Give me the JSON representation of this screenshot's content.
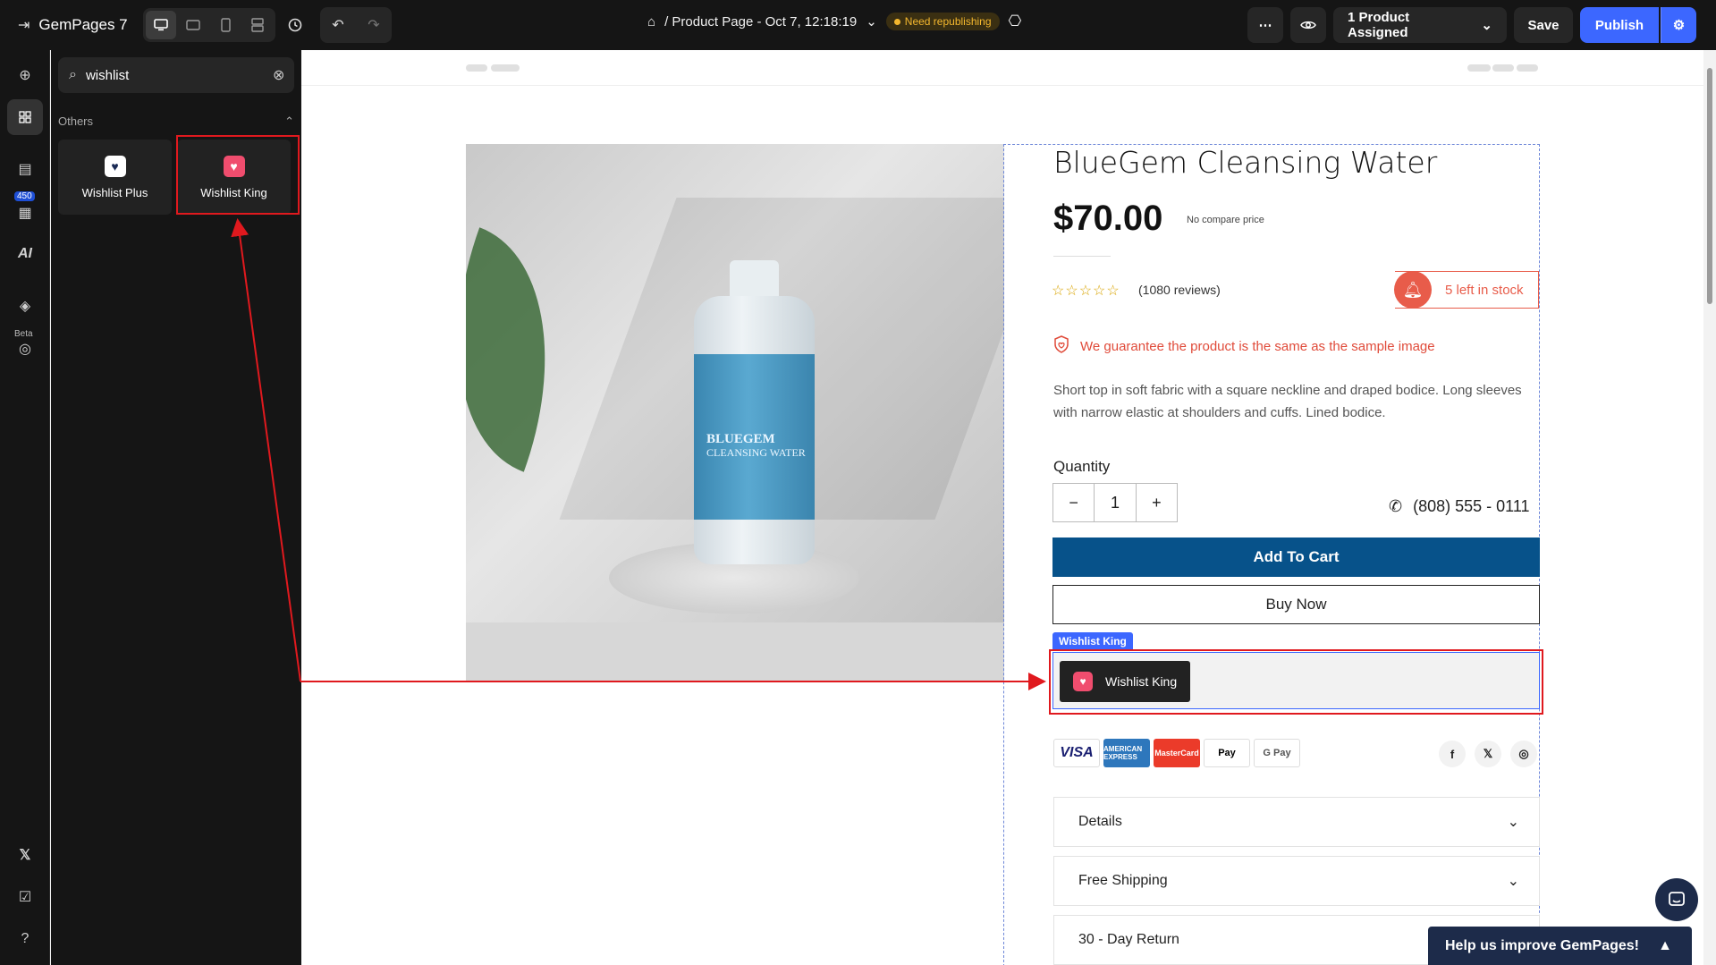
{
  "app": {
    "name": "GemPages 7",
    "page_title": "/ Product Page - Oct 7, 12:18:19",
    "status_badge": "Need republishing",
    "assigned": "1 Product Assigned",
    "save_label": "Save",
    "publish_label": "Publish"
  },
  "rail": {
    "library_count": "450",
    "beta_label": "Beta",
    "ai_label": "AI"
  },
  "panel": {
    "search_value": "wishlist",
    "category": "Others",
    "elements": [
      {
        "label": "Wishlist Plus",
        "icon": "heart-icon"
      },
      {
        "label": "Wishlist King",
        "icon": "heart-icon"
      }
    ]
  },
  "product": {
    "title": "BlueGem Cleansing Water",
    "price": "$70.00",
    "compare_note": "No compare price",
    "rating": 0,
    "reviews": "(1080 reviews)",
    "stock": "5 left in stock",
    "guarantee": "We guarantee the product is the same as the sample image",
    "description": "Short top in soft fabric with a square neckline and draped bodice. Long sleeves with narrow elastic at shoulders and cuffs. Lined bodice.",
    "quantity_label": "Quantity",
    "quantity": "1",
    "phone": "(808) 555 - 0111",
    "add_to_cart": "Add To Cart",
    "buy_now": "Buy Now",
    "wishlist_tag": "Wishlist King",
    "wishlist_button": "Wishlist King",
    "bottle_brand": "BLUEGEM",
    "bottle_sub": "CLEANSING WATER",
    "payments": [
      "VISA",
      "AMERICAN EXPRESS",
      "MasterCard",
      "Pay",
      "G Pay"
    ],
    "social": [
      "f",
      "𝕏",
      "◎"
    ],
    "accordion": [
      "Details",
      "Free Shipping",
      "30 - Day Return"
    ]
  },
  "help_bar": "Help us improve GemPages!",
  "colors": {
    "accent": "#3c67ff",
    "cart": "#07528a",
    "warning": "#e85c4a",
    "highlight": "#e0191e"
  }
}
